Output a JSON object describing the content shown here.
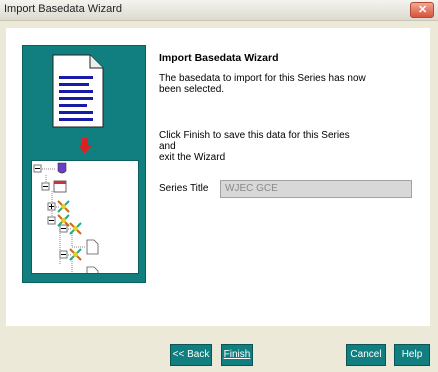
{
  "window": {
    "title": "Import Basedata Wizard"
  },
  "wizard": {
    "heading": "Import Basedata Wizard",
    "line1": "The basedata to import for this Series has now",
    "line2": "been selected.",
    "line3": "Click Finish to save this data for this Series and",
    "line4": "exit the Wizard",
    "series_label": "Series Title",
    "series_value": "WJEC GCE"
  },
  "buttons": {
    "back": "<< Back",
    "finish": "Finish",
    "cancel": "Cancel",
    "help": "Help"
  },
  "icons": [
    "document-icon",
    "red-arrow-icon",
    "tree-root-icon",
    "folder-icon",
    "module-icon",
    "file-icon",
    "close-icon"
  ],
  "colors": {
    "accent": "#117f7f",
    "arrow": "#e02020"
  }
}
